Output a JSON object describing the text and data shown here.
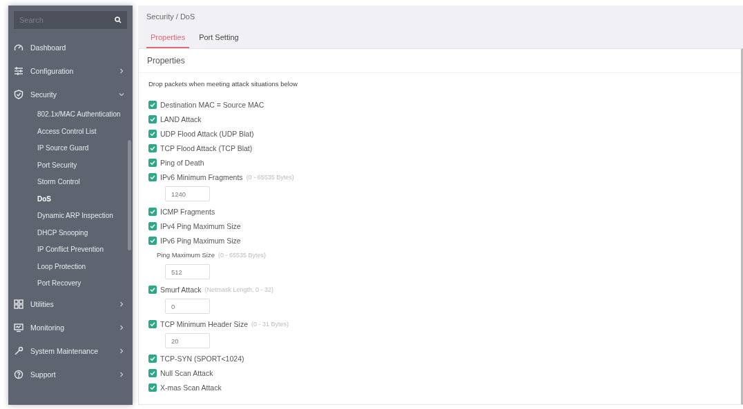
{
  "sidebar": {
    "search": {
      "placeholder": "Search"
    },
    "items": [
      {
        "label": "Dashboard"
      },
      {
        "label": "Configuration",
        "expanded": false
      },
      {
        "label": "Security",
        "expanded": true,
        "children": [
          {
            "label": "802.1x/MAC Authentication",
            "selected": false
          },
          {
            "label": "Access Control List",
            "selected": false
          },
          {
            "label": "IP Source Guard",
            "selected": false
          },
          {
            "label": "Port Security",
            "selected": false
          },
          {
            "label": "Storm Control",
            "selected": false
          },
          {
            "label": "DoS",
            "selected": true
          },
          {
            "label": "Dynamic ARP Inspection",
            "selected": false
          },
          {
            "label": "DHCP Snooping",
            "selected": false
          },
          {
            "label": "IP Conflict Prevention",
            "selected": false
          },
          {
            "label": "Loop Protection",
            "selected": false
          },
          {
            "label": "Port Recovery",
            "selected": false
          }
        ]
      },
      {
        "label": "Utilities",
        "expanded": false
      },
      {
        "label": "Monitoring",
        "expanded": false
      },
      {
        "label": "System Maintenance",
        "expanded": false
      },
      {
        "label": "Support",
        "expanded": false
      }
    ]
  },
  "breadcrumb": "Security / DoS",
  "tabs": [
    {
      "label": "Properties",
      "selected": true
    },
    {
      "label": "Port Setting",
      "selected": false
    }
  ],
  "panel": {
    "title": "Properties",
    "intro": "Drop packets when meeting attack situations below",
    "rows": [
      {
        "kind": "checkbox",
        "label": "Destination MAC = Source MAC",
        "checked": true
      },
      {
        "kind": "checkbox",
        "label": "LAND Attack",
        "checked": true
      },
      {
        "kind": "checkbox",
        "label": "UDP Flood Attack (UDP Blat)",
        "checked": true
      },
      {
        "kind": "checkbox",
        "label": "TCP Flood Attack (TCP Blat)",
        "checked": true
      },
      {
        "kind": "checkbox",
        "label": "Ping of Death",
        "checked": true
      },
      {
        "kind": "checkbox",
        "label": "IPv6 Minimum Fragments",
        "hint": "(0 - 65535 Bytes)",
        "checked": true
      },
      {
        "kind": "field",
        "value": "1240"
      },
      {
        "kind": "checkbox",
        "label": "ICMP Fragments",
        "checked": true
      },
      {
        "kind": "checkbox",
        "label": "IPv4 Ping Maximum Size",
        "checked": true
      },
      {
        "kind": "checkbox",
        "label": "IPv6 Ping Maximum Size",
        "checked": true
      },
      {
        "kind": "sublabel",
        "label": "Ping Maximum Size",
        "hint": "(0 - 65535 Bytes)"
      },
      {
        "kind": "field",
        "value": "512"
      },
      {
        "kind": "checkbox",
        "label": "Smurf Attack",
        "hint": "(Netmask Length, 0 - 32)",
        "checked": true
      },
      {
        "kind": "field",
        "value": "0"
      },
      {
        "kind": "checkbox",
        "label": "TCP Minimum Header Size",
        "hint": "(0 - 31 Bytes)",
        "checked": true
      },
      {
        "kind": "field",
        "value": "20"
      },
      {
        "kind": "checkbox",
        "label": "TCP-SYN (SPORT<1024)",
        "checked": true
      },
      {
        "kind": "checkbox",
        "label": "Null Scan Attack",
        "checked": true
      },
      {
        "kind": "checkbox",
        "label": "X-mas Scan Attack",
        "checked": true
      }
    ]
  }
}
